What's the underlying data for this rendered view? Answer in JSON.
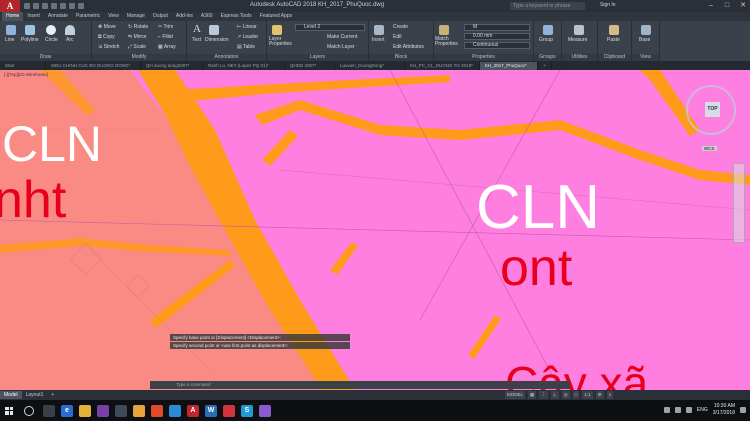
{
  "window": {
    "title": "Autodesk AutoCAD 2018    KH_2017_PhuQuoc.dwg",
    "app_logo": "A",
    "search_placeholder": "Type a keyword or phrase",
    "sign_in": "Sign In"
  },
  "ribbon_tabs": [
    "Home",
    "Insert",
    "Annotate",
    "Parametric",
    "View",
    "Manage",
    "Output",
    "Add-ins",
    "A360",
    "Express Tools",
    "Featured Apps"
  ],
  "ribbon": {
    "draw": {
      "label": "Draw",
      "tools": [
        "Line",
        "Polyline",
        "Circle",
        "Arc"
      ]
    },
    "modify": {
      "label": "Modify",
      "tools": [
        "Move",
        "Rotate",
        "Trim",
        "Copy",
        "Mirror",
        "Fillet",
        "Stretch",
        "Scale",
        "Array"
      ]
    },
    "annotation": {
      "label": "Annotation",
      "tools": [
        "Text",
        "Dimension",
        "Linear",
        "Leader",
        "Table"
      ]
    },
    "layers": {
      "label": "Layers",
      "tools": [
        "Layer Properties",
        "Make Current",
        "Match Layer"
      ],
      "current_layer": "Level 2"
    },
    "block": {
      "label": "Block",
      "tools": [
        "Insert",
        "Create",
        "Edit",
        "Edit Attributes"
      ]
    },
    "properties": {
      "label": "Properties",
      "tools": [
        "Match Properties"
      ],
      "color": "M",
      "lineweight": "0.00 mm",
      "linetype": "Continuous"
    },
    "groups": {
      "label": "Groups",
      "tools": [
        "Group"
      ]
    },
    "utilities": {
      "label": "Utilities",
      "tools": [
        "Measure"
      ]
    },
    "clipboard": {
      "label": "Clipboard",
      "tools": [
        "Paste"
      ]
    },
    "view": {
      "label": "View",
      "tools": [
        "Base"
      ]
    }
  },
  "file_tabs": [
    "Start",
    "SIEU CHINH CUC BO DUONG DONG*",
    "QH duong dong2007*",
    "Ranh Lo, NET (Lopez PQ 01)*",
    "QHDD 2007*",
    "Luuvien_DuongDong*",
    "KH_PC_CL_DUONG TO 2018*",
    "KH_2017_PhuQuoc*"
  ],
  "drawing": {
    "viewport_label": "[-][Top][2D Wireframe]",
    "labels": [
      {
        "code": "CLN",
        "sub": "nht"
      },
      {
        "code": "CLN",
        "sub": "ont"
      },
      {
        "code": "Cây xã"
      }
    ],
    "viewcube_face": "TOP",
    "wcs_label": "WCS",
    "colors": {
      "pink_zone": "#ff7fe0",
      "salmon_zone": "#fa8a84",
      "road": "#ff9a1a",
      "label_white": "#ffffff",
      "label_red": "#e8001a"
    }
  },
  "command": {
    "history": [
      "Specify base point or [Displacement] <Displacement>:",
      "Specify second point or <use first point as displacement>:"
    ],
    "placeholder": "Type a command"
  },
  "layout_tabs": [
    "Model",
    "Layout1"
  ],
  "status": {
    "mode": "MODEL",
    "scale": "1:1"
  },
  "taskbar": {
    "lang": "ENG",
    "time": "10:30 AM",
    "date": "3/17/2018"
  }
}
